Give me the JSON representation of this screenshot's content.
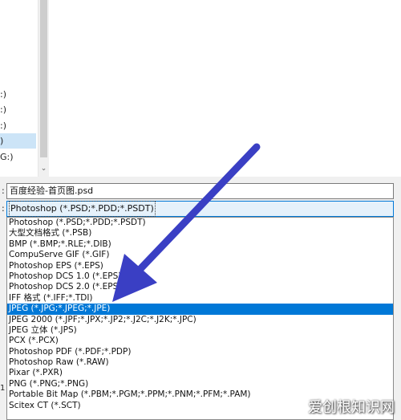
{
  "nav": {
    "items": [
      {
        "label": ":)"
      },
      {
        "label": ":)"
      },
      {
        "label": ":)"
      },
      {
        "label": ")"
      },
      {
        "label": "G:)"
      }
    ],
    "scroll_down_arrow": "⌄"
  },
  "file_name": {
    "label_stub": ":",
    "value": "百度经验-首页图.psd"
  },
  "save_as_type": {
    "label_stub": ":",
    "selected": "Photoshop (*.PSD;*.PDD;*.PSDT)"
  },
  "format_options": [
    "Photoshop (*.PSD;*.PDD;*.PSDT)",
    "大型文档格式 (*.PSB)",
    "BMP (*.BMP;*.RLE;*.DIB)",
    "CompuServe GIF (*.GIF)",
    "Photoshop EPS (*.EPS)",
    "Photoshop DCS 1.0 (*.EPS)",
    "Photoshop DCS 2.0 (*.EPS)",
    "IFF 格式 (*.IFF;*.TDI)",
    "JPEG (*.JPG;*.JPEG;*.JPE)",
    "JPEG 2000 (*.JPF;*.JPX;*.JP2;*.J2C;*.J2K;*.JPC)",
    "JPEG 立体 (*.JPS)",
    "PCX (*.PCX)",
    "Photoshop PDF (*.PDF;*.PDP)",
    "Photoshop Raw (*.RAW)",
    "Pixar (*.PXR)",
    "PNG (*.PNG;*.PNG)",
    "Portable Bit Map (*.PBM;*.PGM;*.PPM;*.PNM;*.PFM;*.PAM)",
    "Scitex CT (*.SCT)"
  ],
  "highlighted_index": 8,
  "edge_digit": "1",
  "watermark": "爱创根知识网",
  "colors": {
    "highlight": "#0078d7",
    "arrow": "#3a3fc4"
  }
}
